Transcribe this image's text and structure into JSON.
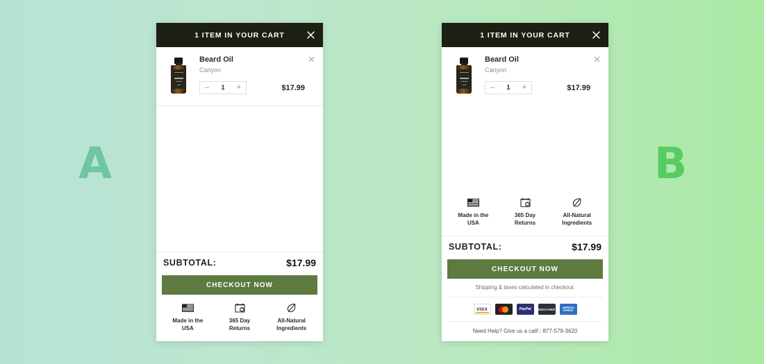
{
  "background": {
    "gradient_start": "#b6e3d6",
    "gradient_end": "#aae9a4"
  },
  "variants": {
    "a_label": "A",
    "b_label": "B"
  },
  "theme": {
    "header_bg": "#1d1e14",
    "checkout_green": "#5e7a40",
    "letter_a_color": "#6ec6a4",
    "letter_b_color": "#57cc63"
  },
  "cart": {
    "header": {
      "title": "1 ITEM IN YOUR CART",
      "close_icon": "close-icon"
    },
    "item": {
      "thumbnail_alt": "beard-oil-bottle",
      "title": "Beard Oil",
      "variant": "Canyon",
      "remove_icon": "close-icon",
      "quantity": {
        "decrement": "–",
        "value": "1",
        "increment": "+"
      },
      "price": "$17.99"
    },
    "trust_badges": [
      {
        "icon": "us-flag-icon",
        "label": "Made in the\nUSA"
      },
      {
        "icon": "calendar-return-icon",
        "label": "365 Day\nReturns"
      },
      {
        "icon": "leaf-icon",
        "label": "All-Natural\nIngredients"
      }
    ],
    "subtotal": {
      "label": "SUBTOTAL:",
      "value": "$17.99"
    },
    "checkout_label": "CHECKOUT NOW"
  },
  "variant_b_extras": {
    "shipping_note": "Shipping & taxes calculated in checkout.",
    "payment_methods": [
      {
        "name": "visa",
        "label": "VISA"
      },
      {
        "name": "mastercard",
        "label": ""
      },
      {
        "name": "paypal",
        "label": "PayPal"
      },
      {
        "name": "discover",
        "label": "DISC●VER"
      },
      {
        "name": "amex",
        "label": "AMERICAN\nEXPRESS"
      }
    ],
    "help_text": "Need Help? Give us a call!",
    "help_separator": "|",
    "phone": "877-579-3620"
  }
}
